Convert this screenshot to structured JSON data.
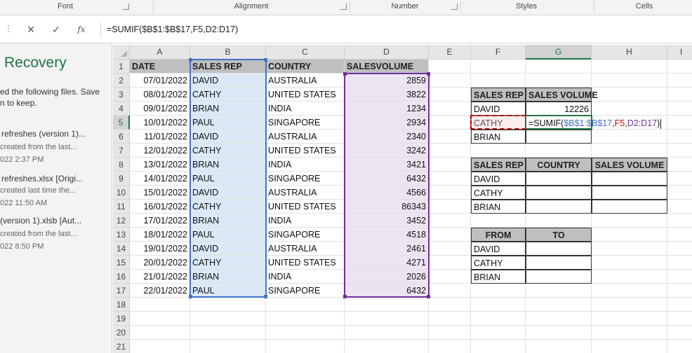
{
  "ribbon": {
    "groups": [
      "Font",
      "Alignment",
      "Number",
      "Styles",
      "Cells"
    ]
  },
  "formula_bar": {
    "handle": "⋮",
    "cancel": "✕",
    "enter": "✓",
    "fx": "fx",
    "formula": "=SUMIF($B$1:$B$17,F5,D2:D17)"
  },
  "recovery": {
    "title": "Recovery",
    "intro_line1": "ed the following files.  Save",
    "intro_line2": "n to keep.",
    "files": [
      {
        "name": "refreshes (version 1)...",
        "desc": "created from the last...",
        "time": "022 2:37 PM"
      },
      {
        "name": "refreshes.xlsx  [Origi...",
        "desc": "created last time the...",
        "time": "022 11:50 AM"
      },
      {
        "name": "(version 1).xlsb  [Aut...",
        "desc": "created from the last...",
        "time": "022 8:50 PM"
      }
    ]
  },
  "grid": {
    "columns": [
      "A",
      "B",
      "C",
      "D",
      "E",
      "F",
      "G",
      "H",
      "I"
    ],
    "rows": [
      "1",
      "2",
      "3",
      "4",
      "5",
      "6",
      "7",
      "8",
      "9",
      "10",
      "11",
      "12",
      "13",
      "14",
      "15",
      "16",
      "17",
      "18",
      "19",
      "20",
      "21"
    ],
    "headers": {
      "a": "DATE",
      "b": "SALES REP",
      "c": "COUNTRY",
      "d": "SALESVOLUME"
    },
    "data": [
      {
        "date": "07/01/2022",
        "rep": "DAVID",
        "country": "AUSTRALIA",
        "volume": "2859"
      },
      {
        "date": "08/01/2022",
        "rep": "CATHY",
        "country": "UNITED STATES",
        "volume": "3822"
      },
      {
        "date": "09/01/2022",
        "rep": "BRIAN",
        "country": "INDIA",
        "volume": "1234"
      },
      {
        "date": "10/01/2022",
        "rep": "PAUL",
        "country": "SINGAPORE",
        "volume": "2934"
      },
      {
        "date": "11/01/2022",
        "rep": "DAVID",
        "country": "AUSTRALIA",
        "volume": "2340"
      },
      {
        "date": "12/01/2022",
        "rep": "CATHY",
        "country": "UNITED STATES",
        "volume": "3242"
      },
      {
        "date": "13/01/2022",
        "rep": "BRIAN",
        "country": "INDIA",
        "volume": "3421"
      },
      {
        "date": "14/01/2022",
        "rep": "PAUL",
        "country": "SINGAPORE",
        "volume": "6432"
      },
      {
        "date": "15/01/2022",
        "rep": "DAVID",
        "country": "AUSTRALIA",
        "volume": "4566"
      },
      {
        "date": "16/01/2022",
        "rep": "CATHY",
        "country": "UNITED STATES",
        "volume": "86343"
      },
      {
        "date": "17/01/2022",
        "rep": "BRIAN",
        "country": "INDIA",
        "volume": "3452"
      },
      {
        "date": "18/01/2022",
        "rep": "PAUL",
        "country": "SINGAPORE",
        "volume": "4518"
      },
      {
        "date": "19/01/2022",
        "rep": "DAVID",
        "country": "AUSTRALIA",
        "volume": "2461"
      },
      {
        "date": "20/01/2022",
        "rep": "CATHY",
        "country": "UNITED STATES",
        "volume": "4271"
      },
      {
        "date": "21/01/2022",
        "rep": "BRIAN",
        "country": "INDIA",
        "volume": "2026"
      },
      {
        "date": "22/01/2022",
        "rep": "PAUL",
        "country": "SINGAPORE",
        "volume": "6432"
      }
    ],
    "summary1": {
      "h1": "SALES REP",
      "h2": "SALES VOLUME",
      "r1": "DAVID",
      "r1v": "12226",
      "r2": "CATHY",
      "r3": "BRIAN",
      "editing_formula_parts": [
        "=SUMIF(",
        "$B$1:$B$17",
        ",",
        "F5",
        ",",
        "D2:D17",
        ")"
      ]
    },
    "summary2": {
      "h1": "SALES REP",
      "h2": "COUNTRY",
      "h3": "SALES VOLUME",
      "r1": "DAVID",
      "r2": "CATHY",
      "r3": "BRIAN"
    },
    "summary3": {
      "h1": "FROM",
      "h2": "TO",
      "r1": "DAVID",
      "r2": "CATHY",
      "r3": "BRIAN"
    }
  },
  "colors": {
    "accent": "#217346",
    "ref_b": "#4472c4",
    "ref_f": "#c00000",
    "ref_d": "#7030a0"
  }
}
